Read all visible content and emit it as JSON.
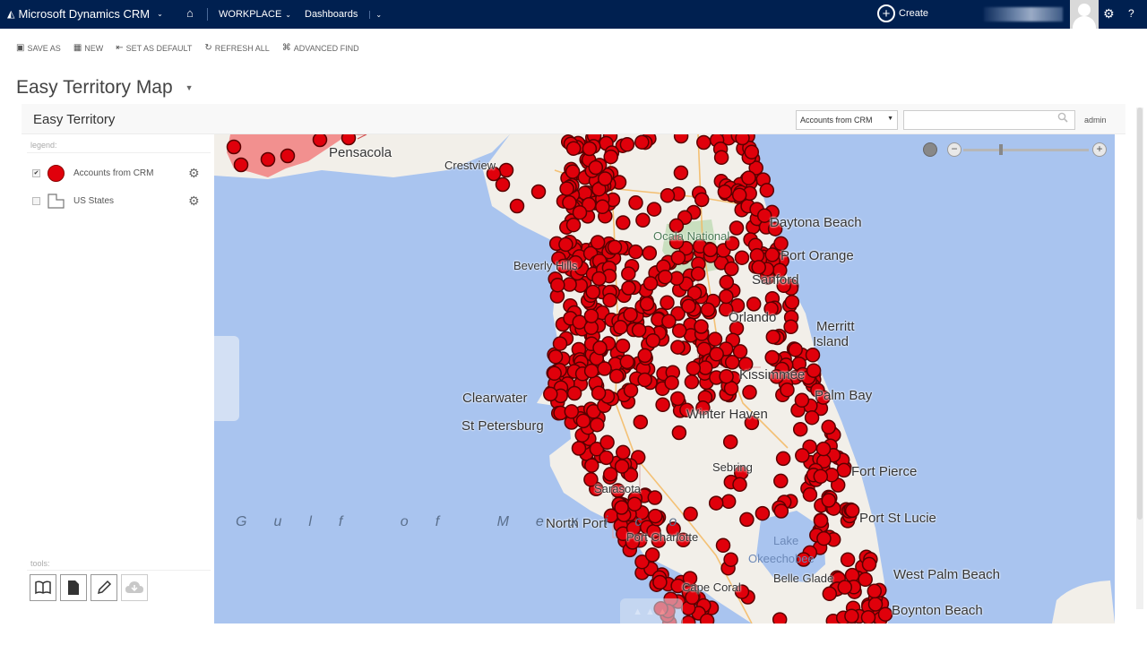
{
  "topnav": {
    "app_title": "Microsoft Dynamics CRM",
    "workplace": "WORKPLACE",
    "dashboards": "Dashboards",
    "create": "Create",
    "help": "?"
  },
  "commands": {
    "save_as": "SAVE AS",
    "new": "NEW",
    "set_default": "SET AS DEFAULT",
    "refresh_all": "REFRESH ALL",
    "advanced_find": "ADVANCED FIND"
  },
  "page": {
    "title": "Easy Territory Map"
  },
  "panel": {
    "title": "Easy Territory",
    "source_select": "Accounts from CRM",
    "search_value": "",
    "user": "admin"
  },
  "legend": {
    "label": "legend:",
    "layers": [
      {
        "label": "Accounts from CRM",
        "checked": true,
        "color": "#e0000b"
      },
      {
        "label": "US States",
        "checked": false
      }
    ]
  },
  "tools": {
    "label": "tools:",
    "buttons": [
      "book-icon",
      "document-icon",
      "pencil-icon",
      "cloud-icon"
    ]
  },
  "map": {
    "marker_color": "#e0000b",
    "water_color": "#a9c4ef",
    "land_color": "#f2efe9",
    "labels": {
      "pensacola": "Pensacola",
      "crestview": "Crestview",
      "daytona": "Daytona Beach",
      "ocala": "Ocala",
      "ocala_nf": "Ocala National",
      "port_orange": "Port Orange",
      "beverly": "Beverly Hills",
      "sanford": "Sanford",
      "orlando": "Orlando",
      "merritt": "Merritt",
      "merritt2": "Island",
      "kissimmee": "Kissimmee",
      "palm_bay": "Palm Bay",
      "clearwater": "Clearwater",
      "st_petersburg": "St Petersburg",
      "winter_haven": "Winter Haven",
      "sebring": "Sebring",
      "fort_pierce": "Fort Pierce",
      "sarasota": "Sarasota",
      "north_port": "North Port",
      "port_st_lucie": "Port St Lucie",
      "port_charlotte": "Port Charlotte",
      "lake": "Lake",
      "okeechobee": "Okeechobee",
      "west_palm": "West Palm Beach",
      "belle_glade": "Belle Glade",
      "cape_coral": "Cape Coral",
      "boynton": "Boynton Beach",
      "gulf": "Gulf of Mexico"
    }
  }
}
